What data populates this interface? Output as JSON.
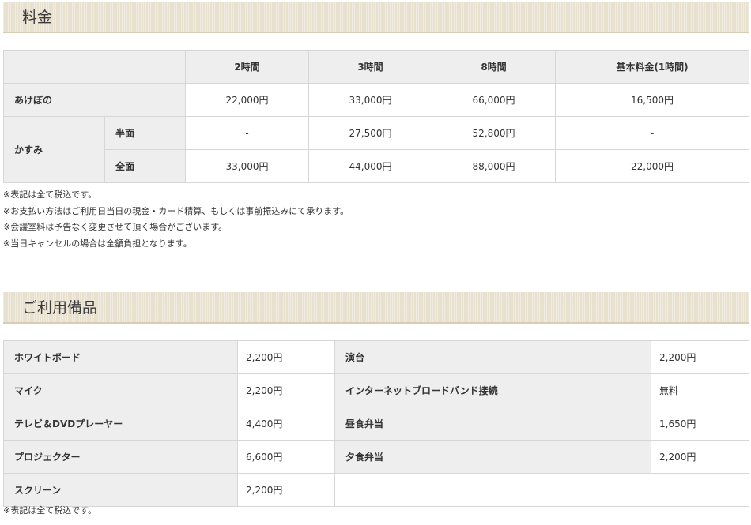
{
  "pricing": {
    "heading": "料金",
    "columns": [
      "2時間",
      "3時間",
      "8時間",
      "基本料金(1時間)"
    ],
    "rooms": {
      "akebono": {
        "name": "あけぼの",
        "values": [
          "22,000円",
          "33,000円",
          "66,000円",
          "16,500円"
        ]
      },
      "kasumi": {
        "name": "かすみ",
        "half": {
          "label": "半面",
          "values": [
            "-",
            "27,500円",
            "52,800円",
            "-"
          ]
        },
        "full": {
          "label": "全面",
          "values": [
            "33,000円",
            "44,000円",
            "88,000円",
            "22,000円"
          ]
        }
      }
    },
    "notes": [
      "※表記は全て税込です。",
      "※お支払い方法はご利用日当日の現金・カード精算、もしくは事前振込みにて承ります。",
      "※会議室料は予告なく変更させて頂く場合がございます。",
      "※当日キャンセルの場合は全額負担となります。"
    ]
  },
  "equipment": {
    "heading": "ご利用備品",
    "rows": [
      [
        {
          "name": "ホワイトボード",
          "price": "2,200円"
        },
        {
          "name": "演台",
          "price": "2,200円"
        }
      ],
      [
        {
          "name": "マイク",
          "price": "2,200円"
        },
        {
          "name": "インターネットブロードバンド接続",
          "price": "無料"
        }
      ],
      [
        {
          "name": "テレビ＆DVDプレーヤー",
          "price": "4,400円"
        },
        {
          "name": "昼食弁当",
          "price": "1,650円"
        }
      ],
      [
        {
          "name": "プロジェクター",
          "price": "6,600円"
        },
        {
          "name": "夕食弁当",
          "price": "2,200円"
        }
      ],
      [
        {
          "name": "スクリーン",
          "price": "2,200円"
        }
      ]
    ],
    "note": "※表記は全て税込です。"
  }
}
